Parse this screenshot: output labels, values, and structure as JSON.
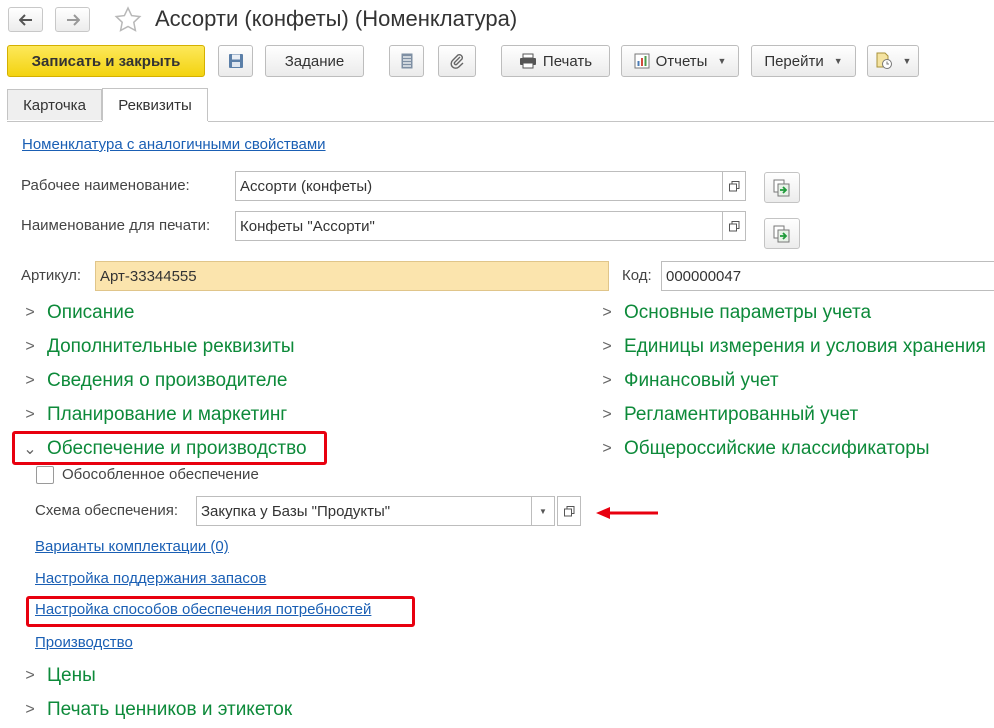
{
  "window": {
    "title": "Ассорти (конфеты) (Номенклатура)"
  },
  "nav": {
    "back_icon": "arrow-left-icon",
    "forward_icon": "arrow-right-icon",
    "favorite_icon": "star-icon"
  },
  "toolbar": {
    "save_close_label": "Записать и закрыть",
    "save_icon": "floppy-icon",
    "task_label": "Задание",
    "list_icon": "list-icon",
    "attach_icon": "paperclip-icon",
    "print_label": "Печать",
    "reports_label": "Отчеты",
    "goto_label": "Перейти",
    "more_icon": "clock-document-icon"
  },
  "tabs": [
    {
      "label": "Карточка"
    },
    {
      "label": "Реквизиты"
    }
  ],
  "form": {
    "similar_link": "Номенклатура с аналогичными свойствами",
    "work_name_label": "Рабочее наименование:",
    "work_name_value": "Ассорти (конфеты)",
    "print_name_label": "Наименование для печати:",
    "print_name_value": "Конфеты \"Ассорти\"",
    "article_label": "Артикул:",
    "article_value": "Арт-33344555",
    "code_label": "Код:",
    "code_value": "000000047"
  },
  "groups_left": [
    {
      "label": "Описание"
    },
    {
      "label": "Дополнительные реквизиты"
    },
    {
      "label": "Сведения о производителе"
    },
    {
      "label": "Планирование и маркетинг"
    },
    {
      "label": "Обеспечение и производство"
    }
  ],
  "groups_right": [
    {
      "label": "Основные параметры учета"
    },
    {
      "label": "Единицы измерения и условия хранения"
    },
    {
      "label": "Финансовый учет"
    },
    {
      "label": "Регламентированный учет"
    },
    {
      "label": "Общероссийские классификаторы"
    }
  ],
  "supply": {
    "separate_checkbox_label": "Обособленное обеспечение",
    "scheme_label": "Схема обеспечения:",
    "scheme_value": "Закупка у Базы \"Продукты\"",
    "links": [
      {
        "label": "Варианты комплектации (0)"
      },
      {
        "label": "Настройка поддержания запасов"
      },
      {
        "label": "Настройка способов обеспечения потребностей"
      },
      {
        "label": "Производство"
      }
    ]
  },
  "groups_bottom": [
    {
      "label": "Цены"
    },
    {
      "label": "Печать ценников и этикеток"
    }
  ],
  "colors": {
    "primary_button": "#f3d310",
    "group_text": "#0d8a3a",
    "link": "#1a5fb4",
    "highlight": "#e8000f",
    "article_bg": "#fbe4ad"
  }
}
